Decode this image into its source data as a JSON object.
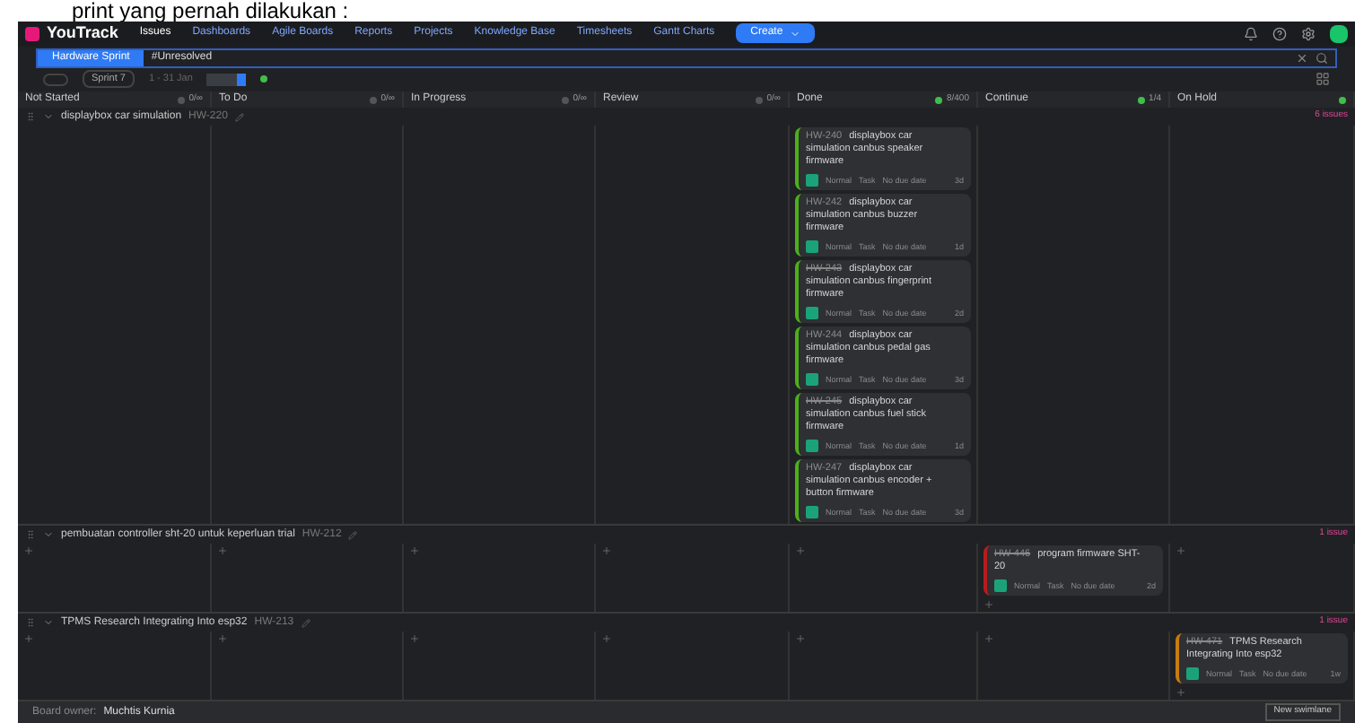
{
  "doc_caption": "print yang pernah dilakukan :",
  "nav": {
    "logo": "YouTrack",
    "items": [
      {
        "label": "Issues",
        "selected": true
      },
      {
        "label": "Dashboards",
        "selected": false
      },
      {
        "label": "Agile Boards",
        "selected": false
      },
      {
        "label": "Reports",
        "selected": false
      },
      {
        "label": "Projects",
        "selected": false
      },
      {
        "label": "Knowledge Base",
        "selected": false
      },
      {
        "label": "Timesheets",
        "selected": false
      },
      {
        "label": "Gantt Charts",
        "selected": false
      }
    ],
    "create": "Create"
  },
  "search": {
    "board": "Hardware Sprint",
    "query": "#Unresolved"
  },
  "toolbar": {
    "sprint": "Sprint 7",
    "date": "1 - 31 Jan"
  },
  "columns": [
    {
      "name": "Not Started",
      "count": "0/∞",
      "ok": false
    },
    {
      "name": "To Do",
      "count": "0/∞",
      "ok": false
    },
    {
      "name": "In Progress",
      "count": "0/∞",
      "ok": false
    },
    {
      "name": "Review",
      "count": "0/∞",
      "ok": false
    },
    {
      "name": "Done",
      "count": "8/400",
      "ok": true
    },
    {
      "name": "Continue",
      "count": "1/4",
      "ok": true
    },
    {
      "name": "On Hold",
      "ok": true
    }
  ],
  "swimlanes": [
    {
      "title": "displaybox car simulation",
      "id": "HW-220",
      "issues": "6 issues",
      "cells": [
        [],
        [],
        [],
        [],
        [
          {
            "id": "HW-240",
            "title": "displaybox car simulation canbus speaker firmware",
            "priority": "Normal",
            "type": "Task",
            "due": "No due date",
            "estimate": "3d",
            "resolved": false,
            "color": "#4caf1a"
          },
          {
            "id": "HW-242",
            "title": "displaybox car simulation canbus buzzer firmware",
            "priority": "Normal",
            "type": "Task",
            "due": "No due date",
            "estimate": "1d",
            "resolved": false,
            "color": "#4caf1a"
          },
          {
            "id": "HW-243",
            "title": "displaybox car simulation canbus fingerprint firmware",
            "priority": "Normal",
            "type": "Task",
            "due": "No due date",
            "estimate": "2d",
            "resolved": true,
            "color": "#4caf1a"
          },
          {
            "id": "HW-244",
            "title": "displaybox car simulation canbus pedal gas firmware",
            "priority": "Normal",
            "type": "Task",
            "due": "No due date",
            "estimate": "3d",
            "resolved": false,
            "color": "#4caf1a"
          },
          {
            "id": "HW-245",
            "title": "displaybox car simulation canbus fuel stick firmware",
            "priority": "Normal",
            "type": "Task",
            "due": "No due date",
            "estimate": "1d",
            "resolved": true,
            "color": "#4caf1a"
          },
          {
            "id": "HW-247",
            "title": "displaybox car simulation canbus encoder + button firmware",
            "priority": "Normal",
            "type": "Task",
            "due": "No due date",
            "estimate": "3d",
            "resolved": false,
            "color": "#4caf1a"
          }
        ],
        [],
        []
      ]
    },
    {
      "title": "pembuatan controller sht-20 untuk keperluan trial",
      "id": "HW-212",
      "issues": "1 issue",
      "cells": [
        [],
        [],
        [],
        [],
        [],
        [
          {
            "id": "HW-446",
            "title": "program firmware SHT-20",
            "priority": "Normal",
            "type": "Task",
            "due": "No due date",
            "estimate": "2d",
            "resolved": true,
            "color": "#b71c1c"
          }
        ],
        []
      ]
    },
    {
      "title": "TPMS Research Integrating Into esp32",
      "id": "HW-213",
      "issues": "1 issue",
      "cells": [
        [],
        [],
        [],
        [],
        [],
        [],
        [
          {
            "id": "HW-471",
            "title": "TPMS Research Integrating Into esp32",
            "priority": "Normal",
            "type": "Task",
            "due": "No due date",
            "estimate": "1w",
            "resolved": true,
            "color": "#c77c0e"
          }
        ]
      ]
    }
  ],
  "footer": {
    "label": "Board owner:",
    "owner": "Muchtis Kurnia",
    "button": "New swimlane"
  }
}
